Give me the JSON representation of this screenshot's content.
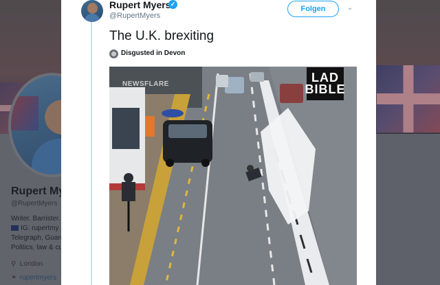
{
  "background_profile": {
    "name": "Rupert My",
    "handle": "@RupertMyers",
    "bio_lines": [
      "Writer. Barrister.",
      "IG: rupertmy",
      "Telegraph, Guard",
      "Politics, law & cu"
    ],
    "location": "London",
    "link": "rupertmyers"
  },
  "tweet": {
    "author": {
      "display_name": "Rupert Myers",
      "handle": "@RupertMyers",
      "verified": true
    },
    "follow_label": "Folgen",
    "text": "The U.K. brexiting",
    "place": "Disgusted in Devon",
    "media": {
      "logo_line1": "LAD",
      "logo_line2": "BIBLE",
      "watermark": "NEWSFLARE"
    }
  },
  "icons": {
    "verified": "verified-badge-icon",
    "caret": "chevron-down-icon",
    "place": "place-icon",
    "location": "map-pin-icon",
    "link": "link-icon"
  },
  "colors": {
    "accent": "#1da1f2",
    "text": "#14171a",
    "muted": "#657786"
  }
}
